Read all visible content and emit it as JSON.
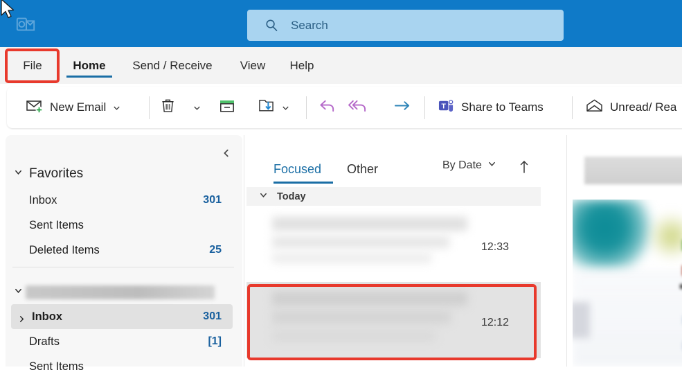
{
  "app": {
    "logo_icon": "outlook-logo-icon",
    "header_color": "#0f7ac8",
    "accent_color": "#1a6ea5",
    "annotation_color": "#e8392c"
  },
  "search": {
    "icon": "search-icon",
    "placeholder": "Search",
    "value": ""
  },
  "ribbon_tabs": [
    {
      "id": "file",
      "label": "File",
      "active": false,
      "highlighted": true
    },
    {
      "id": "home",
      "label": "Home",
      "active": true,
      "highlighted": false
    },
    {
      "id": "send_receive",
      "label": "Send / Receive",
      "active": false,
      "highlighted": false
    },
    {
      "id": "view",
      "label": "View",
      "active": false,
      "highlighted": false
    },
    {
      "id": "help",
      "label": "Help",
      "active": false,
      "highlighted": false
    }
  ],
  "toolbar": {
    "new_email_label": "New Email",
    "new_email_icon": "new-mail-icon",
    "delete_icon": "trash-icon",
    "archive_icon": "archive-icon",
    "move_icon": "move-to-folder-icon",
    "undo_icon": "reply-icon",
    "reply_all_icon": "reply-all-icon",
    "forward_icon": "forward-arrow-icon",
    "teams_icon": "teams-icon",
    "share_to_teams_label": "Share to Teams",
    "unread_icon": "open-envelope-icon",
    "unread_read_label": "Unread/ Rea",
    "dropdown_icon": "chevron-down-icon"
  },
  "sidebar": {
    "collapse_icon": "chevron-left-icon",
    "expand_icon": "chevron-down-icon",
    "groups": [
      {
        "label": "Favorites",
        "expanded": true,
        "items": [
          {
            "label": "Inbox",
            "count": "301"
          },
          {
            "label": "Sent Items",
            "count": ""
          },
          {
            "label": "Deleted Items",
            "count": "25"
          }
        ]
      },
      {
        "label": "",
        "blurred": true,
        "expanded": true,
        "items": [
          {
            "label": "Inbox",
            "count": "301",
            "selected": true,
            "has_caret": true
          },
          {
            "label": "Drafts",
            "count": "[1]"
          },
          {
            "label": "Sent Items",
            "count": ""
          }
        ]
      }
    ]
  },
  "message_list": {
    "tabs": [
      {
        "label": "Focused",
        "active": true
      },
      {
        "label": "Other",
        "active": false
      }
    ],
    "sort_label": "By Date",
    "sort_dropdown_icon": "chevron-down-icon",
    "sort_direction_icon": "arrow-up-icon",
    "group_header": {
      "label": "Today",
      "expand_icon": "chevron-down-icon"
    },
    "messages": [
      {
        "time": "12:33",
        "selected": false,
        "highlighted": false,
        "redacted": true
      },
      {
        "time": "12:12",
        "selected": true,
        "highlighted": true,
        "redacted": true
      }
    ],
    "scrollbar": {
      "up_icon": "scroll-up-arrow-icon"
    }
  },
  "reading_pane": {
    "redacted": true
  }
}
